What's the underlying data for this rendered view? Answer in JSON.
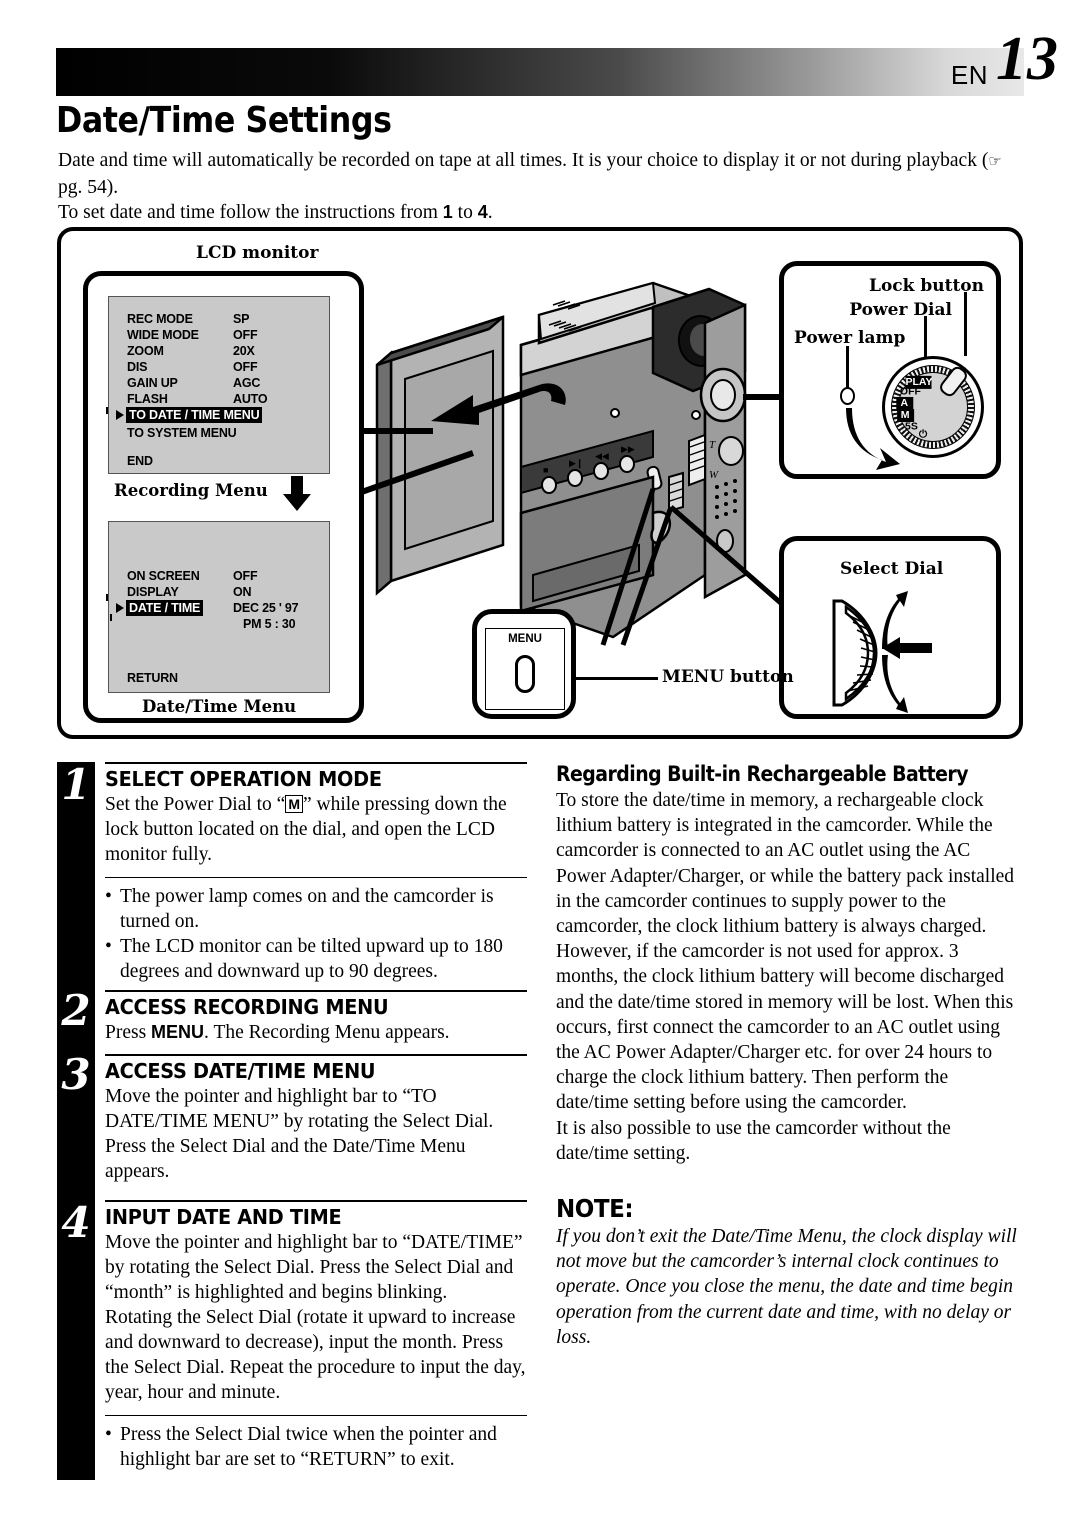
{
  "header": {
    "lang_code": "EN",
    "page_number": "13"
  },
  "title": "Date/Time Settings",
  "intro": {
    "line1_a": "Date and time will automatically be recorded on tape at all times. It is your choice to display it or not during playback (",
    "pointer_icon": "hand-pointing-icon",
    "line1_b": " pg. 54).",
    "line2_a": "To set date and time follow the instructions from ",
    "line2_num1": "1",
    "line2_mid": " to ",
    "line2_num2": "4",
    "line2_end": "."
  },
  "figure": {
    "lcd_monitor_label": "LCD monitor",
    "recording_menu_label": "Recording Menu",
    "datetime_menu_label": "Date/Time Menu",
    "recording_menu": {
      "rows": [
        {
          "label": "REC MODE",
          "value": "SP"
        },
        {
          "label": "WIDE MODE",
          "value": "OFF"
        },
        {
          "label": "ZOOM",
          "value": "20X"
        },
        {
          "label": "DIS",
          "value": "OFF"
        },
        {
          "label": "GAIN UP",
          "value": "AGC"
        },
        {
          "label": "FLASH",
          "value": "AUTO"
        }
      ],
      "highlighted_item": "TO DATE / TIME MENU",
      "plain_item": "TO SYSTEM MENU",
      "end_item": "END"
    },
    "datetime_menu": {
      "rows": [
        {
          "label": "ON SCREEN",
          "value": "OFF"
        },
        {
          "label": "DISPLAY",
          "value": "ON"
        }
      ],
      "highlighted_item": "DATE / TIME",
      "date_value": "DEC 25 ' 97",
      "time_value": "PM  5 : 30",
      "return_item": "RETURN"
    },
    "power_panel": {
      "lock_button_label": "Lock button",
      "power_dial_label": "Power Dial",
      "power_lamp_label": "Power lamp",
      "dial_marks": [
        "⏻",
        "5S",
        "M",
        "A",
        "OFF",
        "PLAY"
      ]
    },
    "select_dial_label": "Select Dial",
    "menu_button": {
      "button_face_text": "MENU",
      "callout_label": "MENU button"
    }
  },
  "steps": [
    {
      "number": "1",
      "heading": "SELECT OPERATION MODE",
      "text_a": "Set the Power Dial to “",
      "text_key": "M",
      "text_b": "” while pressing down the lock button located on the dial, and open the LCD monitor fully.",
      "bullets": [
        "The power lamp comes on and the camcorder is turned on.",
        "The LCD monitor can be tilted upward up to 180 degrees and downward up to 90 degrees."
      ]
    },
    {
      "number": "2",
      "heading": "ACCESS RECORDING MENU",
      "text_a": "Press ",
      "text_key": "MENU",
      "text_b": ". The Recording Menu appears.",
      "bullets": []
    },
    {
      "number": "3",
      "heading": "ACCESS DATE/TIME MENU",
      "text_a": "Move the pointer and highlight bar to “TO DATE/TIME MENU” by rotating the Select Dial. Press the Select Dial and the Date/Time Menu appears.",
      "text_key": "",
      "text_b": "",
      "bullets": []
    },
    {
      "number": "4",
      "heading": "INPUT DATE AND TIME",
      "text_a": "Move the pointer and highlight bar to “DATE/TIME” by rotating the Select Dial. Press the Select Dial and “month” is highlighted and begins blinking.\nRotating the Select Dial (rotate it upward to increase and downward to decrease), input the month. Press the Select Dial. Repeat the procedure to input the day, year, hour and minute.",
      "text_key": "",
      "text_b": "",
      "bullets": [
        "Press the Select Dial twice when the pointer and highlight bar are set to “RETURN” to exit."
      ]
    }
  ],
  "right_column": {
    "battery_heading": "Regarding Built-in Rechargeable Battery",
    "battery_text": "To store the date/time in memory, a rechargeable clock lithium battery is integrated in the camcorder. While the camcorder is connected to an AC outlet using the AC Power Adapter/Charger, or while the battery pack installed in the camcorder continues to supply power to the camcorder, the clock lithium battery is always charged. However, if the camcorder is not used for approx. 3 months, the clock lithium battery will become discharged and the date/time stored in memory will be lost. When this occurs, first connect the camcorder to an AC outlet using the AC Power Adapter/Charger etc. for over 24 hours to charge the clock lithium battery. Then perform the date/time setting before using the camcorder.\nIt is also possible to use the camcorder without the date/time setting.",
    "note_heading": "NOTE:",
    "note_text": "If you don’t exit the Date/Time Menu, the clock display will not move but the camcorder’s internal clock continues to operate. Once you close the menu, the date and time begin operation from the current date and time, with no delay or loss."
  },
  "colors": {
    "ink": "#000000",
    "screen_bg": "#c9c9c9",
    "body_gray": "#9a9a9a"
  }
}
